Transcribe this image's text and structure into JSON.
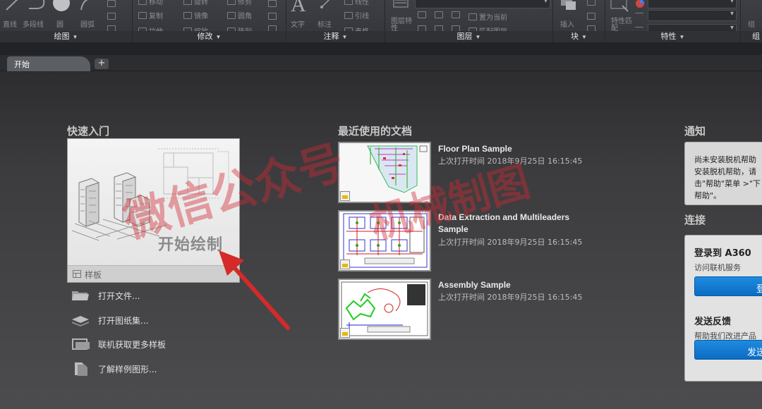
{
  "ribbon": {
    "panels": [
      {
        "title": "绘图",
        "tools": [
          "直线",
          "多段线",
          "圆",
          "圆弧"
        ]
      },
      {
        "title": "修改",
        "tools": [
          "移动",
          "旋转",
          "修剪",
          "复制",
          "镜像",
          "圆角",
          "拉伸",
          "缩放",
          "阵列"
        ]
      },
      {
        "title": "注释",
        "tools": [
          "文字",
          "标注",
          "线性",
          "引线",
          "表格"
        ]
      },
      {
        "title": "图层",
        "tools": [
          "图层特性",
          "置为当前",
          "匹配图层"
        ]
      },
      {
        "title": "块",
        "tools": [
          "插入"
        ]
      },
      {
        "title": "特性",
        "tools": [
          "特性匹配"
        ]
      },
      {
        "title": "组",
        "tools": [
          "组"
        ]
      }
    ]
  },
  "tabs": {
    "start_label": "开始",
    "add_label": "+"
  },
  "quick_start": {
    "title": "快速入门",
    "card_label": "开始绘制",
    "template_label": "样板",
    "links": [
      {
        "label": "打开文件...",
        "icon": "folder-icon"
      },
      {
        "label": "打开图纸集...",
        "icon": "sheet-set-icon"
      },
      {
        "label": "联机获取更多样板",
        "icon": "online-templates-icon"
      },
      {
        "label": "了解样例图形...",
        "icon": "sample-drawings-icon"
      }
    ]
  },
  "recent": {
    "title": "最近使用的文档",
    "docs": [
      {
        "name": "Floor Plan Sample",
        "time": "上次打开时间 2018年9月25日 16:15:45"
      },
      {
        "name": "Data Extraction and Multileaders Sample",
        "time": "上次打开时间 2018年9月25日 16:15:45"
      },
      {
        "name": "Assembly Sample",
        "time": "上次打开时间 2018年9月25日 16:15:45"
      }
    ]
  },
  "notifications": {
    "title": "通知",
    "lines": [
      "尚未安装脱机帮助",
      "安装脱机帮助，请",
      "击\"帮助\"菜单 >\"下",
      "帮助\"。"
    ]
  },
  "connect": {
    "title": "连接",
    "login_title": "登录到 A360",
    "login_desc": "访问联机服务",
    "login_button": "登",
    "feedback_title": "发送反馈",
    "feedback_desc": "帮助我们改进产品",
    "feedback_button": "发送"
  },
  "watermark": {
    "line1": "微信公众号",
    "line2": "机械制图"
  },
  "colors": {
    "accent_blue": "#1e8be0",
    "annotation_arrow": "#d42a2a",
    "watermark": "#d22832"
  }
}
